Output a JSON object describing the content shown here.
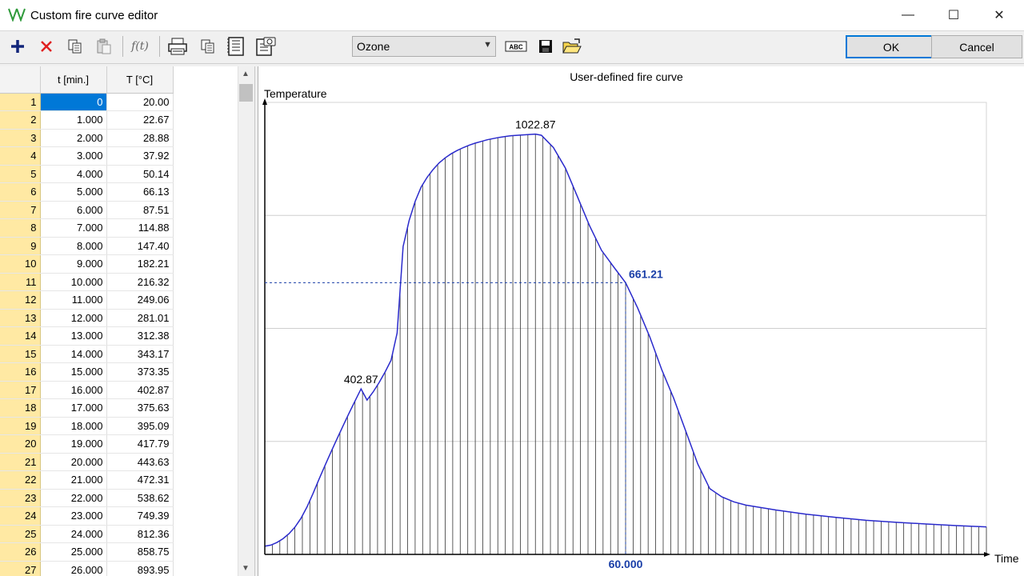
{
  "window": {
    "title": "Custom fire curve editor",
    "minimize_glyph": "—",
    "maximize_glyph": "☐",
    "close_glyph": "✕"
  },
  "toolbar": {
    "icons": [
      "add-icon",
      "delete-icon",
      "copy-icon",
      "paste-icon",
      "function-icon",
      "print-icon",
      "copy-chart-icon",
      "report-icon",
      "screenshot-icon",
      "text-abc-icon",
      "save-icon",
      "open-folder-icon"
    ],
    "function_label": "f(t)",
    "abc_label": "ABC",
    "curve_select": {
      "value": "Ozone"
    },
    "ok_label": "OK",
    "cancel_label": "Cancel"
  },
  "table": {
    "headers": {
      "row": "",
      "time": "t [min.]",
      "temp": "T [°C]"
    },
    "rows": [
      {
        "n": "1",
        "t": "0",
        "T": "20.00"
      },
      {
        "n": "2",
        "t": "1.000",
        "T": "22.67"
      },
      {
        "n": "3",
        "t": "2.000",
        "T": "28.88"
      },
      {
        "n": "4",
        "t": "3.000",
        "T": "37.92"
      },
      {
        "n": "5",
        "t": "4.000",
        "T": "50.14"
      },
      {
        "n": "6",
        "t": "5.000",
        "T": "66.13"
      },
      {
        "n": "7",
        "t": "6.000",
        "T": "87.51"
      },
      {
        "n": "8",
        "t": "7.000",
        "T": "114.88"
      },
      {
        "n": "9",
        "t": "8.000",
        "T": "147.40"
      },
      {
        "n": "10",
        "t": "9.000",
        "T": "182.21"
      },
      {
        "n": "11",
        "t": "10.000",
        "T": "216.32"
      },
      {
        "n": "12",
        "t": "11.000",
        "T": "249.06"
      },
      {
        "n": "13",
        "t": "12.000",
        "T": "281.01"
      },
      {
        "n": "14",
        "t": "13.000",
        "T": "312.38"
      },
      {
        "n": "15",
        "t": "14.000",
        "T": "343.17"
      },
      {
        "n": "16",
        "t": "15.000",
        "T": "373.35"
      },
      {
        "n": "17",
        "t": "16.000",
        "T": "402.87"
      },
      {
        "n": "18",
        "t": "17.000",
        "T": "375.63"
      },
      {
        "n": "19",
        "t": "18.000",
        "T": "395.09"
      },
      {
        "n": "20",
        "t": "19.000",
        "T": "417.79"
      },
      {
        "n": "21",
        "t": "20.000",
        "T": "443.63"
      },
      {
        "n": "22",
        "t": "21.000",
        "T": "472.31"
      },
      {
        "n": "23",
        "t": "22.000",
        "T": "538.62"
      },
      {
        "n": "24",
        "t": "23.000",
        "T": "749.39"
      },
      {
        "n": "25",
        "t": "24.000",
        "T": "812.36"
      },
      {
        "n": "26",
        "t": "25.000",
        "T": "858.75"
      },
      {
        "n": "27",
        "t": "26.000",
        "T": "893.95"
      }
    ]
  },
  "chart_data": {
    "type": "area",
    "title": "User-defined fire curve",
    "ylabel": "Temperature",
    "xlabel": "Time",
    "annotations": [
      {
        "x": 16,
        "y": 402.87,
        "label": "402.87"
      },
      {
        "x": 45,
        "y": 1022.87,
        "label": "1022.87"
      },
      {
        "x": 60,
        "y": 661.21,
        "label": "661.21",
        "crosshair": true,
        "x_label": "60.000"
      }
    ],
    "xlim": [
      0,
      120
    ],
    "ylim": [
      0,
      1100
    ],
    "grid": true,
    "x": [
      0,
      1,
      2,
      3,
      4,
      5,
      6,
      7,
      8,
      9,
      10,
      11,
      12,
      13,
      14,
      15,
      16,
      17,
      18,
      19,
      20,
      21,
      22,
      23,
      24,
      25,
      26,
      27,
      28,
      29,
      30,
      31,
      32,
      33,
      34,
      35,
      36,
      37,
      38,
      39,
      40,
      41,
      42,
      43,
      44,
      45,
      46,
      48,
      50,
      52,
      54,
      56,
      58,
      60,
      62,
      64,
      66,
      68,
      70,
      72,
      74,
      76,
      78,
      80,
      85,
      90,
      95,
      100,
      105,
      110,
      115,
      120
    ],
    "series": [
      {
        "values": [
          20.0,
          22.67,
          28.88,
          37.92,
          50.14,
          66.13,
          87.51,
          114.88,
          147.4,
          182.21,
          216.32,
          249.06,
          281.01,
          312.38,
          343.17,
          373.35,
          402.87,
          375.63,
          395.09,
          417.79,
          443.63,
          472.31,
          538.62,
          749.39,
          812.36,
          858.75,
          893.95,
          918,
          937,
          953,
          965,
          975,
          983,
          990,
          996,
          1001,
          1005,
          1009,
          1012,
          1015,
          1017,
          1019,
          1020,
          1021,
          1022,
          1022.87,
          1020,
          990,
          940,
          870,
          800,
          740,
          700,
          661.21,
          600,
          530,
          450,
          380,
          300,
          220,
          160,
          140,
          128,
          120,
          108,
          98,
          90,
          83,
          78,
          74,
          70,
          67
        ]
      }
    ]
  }
}
